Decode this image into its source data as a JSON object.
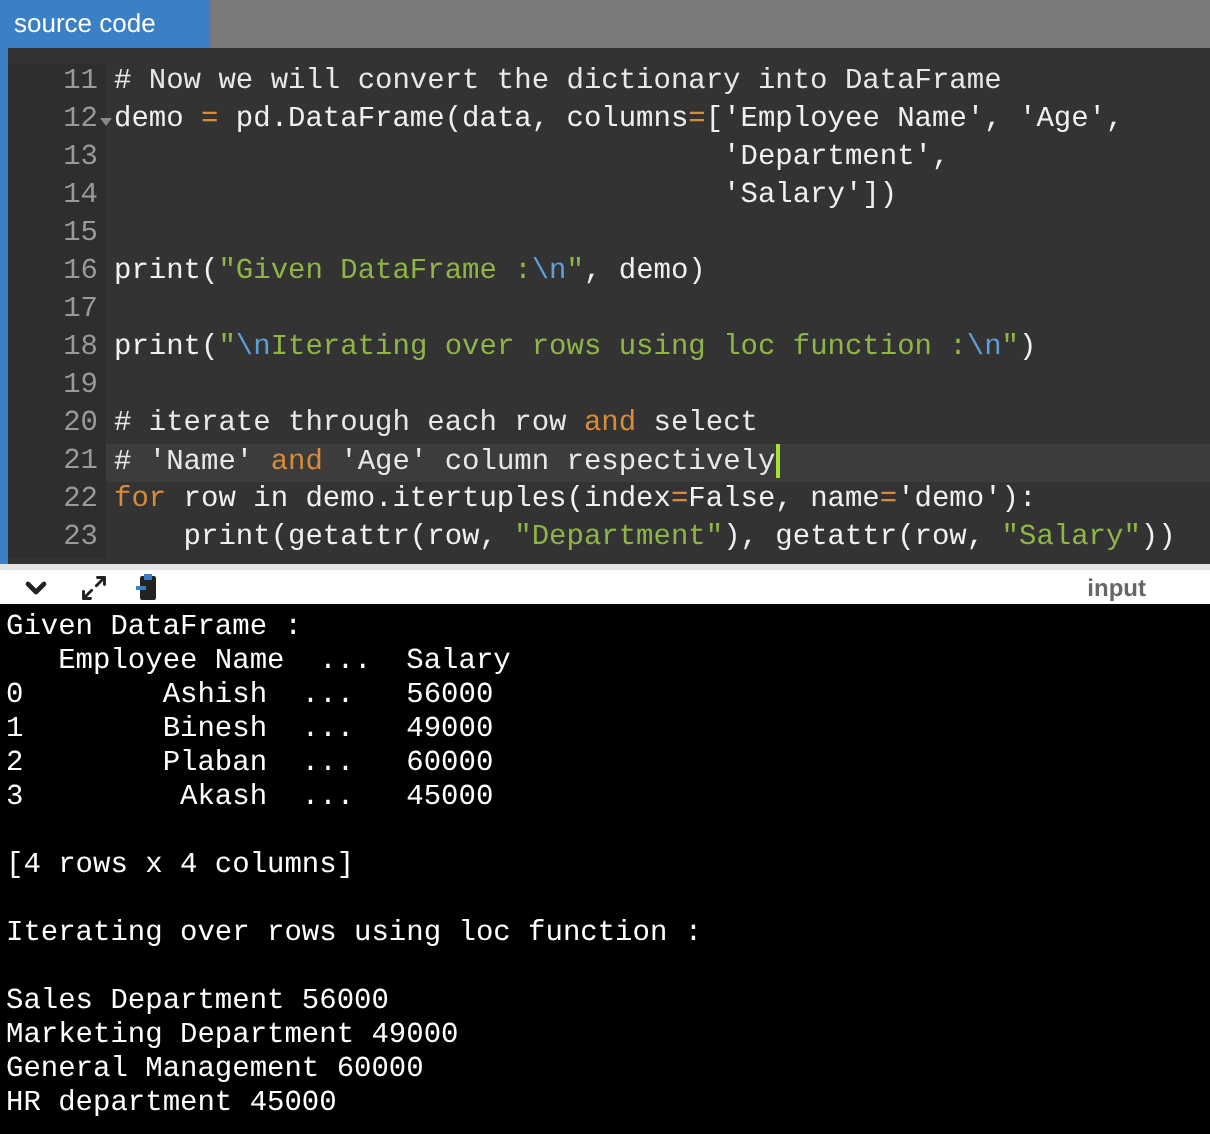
{
  "tab": {
    "label": "source code",
    "selected": true
  },
  "code_lines": [
    {
      "number": "11",
      "foldable": false,
      "active": false,
      "tokens": [
        {
          "kind": "comment",
          "text": "# Now we will convert the dictionary into DataFrame"
        }
      ]
    },
    {
      "number": "12",
      "foldable": true,
      "active": false,
      "tokens": [
        {
          "kind": "plain",
          "text": "demo "
        },
        {
          "kind": "op",
          "text": "="
        },
        {
          "kind": "plain",
          "text": " pd.DataFrame(data, columns"
        },
        {
          "kind": "op",
          "text": "="
        },
        {
          "kind": "plain",
          "text": "['Employee Name', 'Age',"
        }
      ]
    },
    {
      "number": "13",
      "foldable": false,
      "active": false,
      "tokens": [
        {
          "kind": "plain",
          "text": "                                   'Department',"
        }
      ]
    },
    {
      "number": "14",
      "foldable": false,
      "active": false,
      "tokens": [
        {
          "kind": "plain",
          "text": "                                   'Salary'])"
        }
      ]
    },
    {
      "number": "15",
      "foldable": false,
      "active": false
    },
    {
      "number": "16",
      "foldable": false,
      "active": false,
      "tokens": [
        {
          "kind": "plain",
          "text": "print("
        },
        {
          "kind": "str",
          "text": "\"Given DataFrame :"
        },
        {
          "kind": "esc",
          "text": "\\n"
        },
        {
          "kind": "str",
          "text": "\""
        },
        {
          "kind": "plain",
          "text": ", demo)"
        }
      ]
    },
    {
      "number": "17",
      "foldable": false,
      "active": false
    },
    {
      "number": "18",
      "foldable": false,
      "active": false,
      "tokens": [
        {
          "kind": "plain",
          "text": "print("
        },
        {
          "kind": "str",
          "text": "\""
        },
        {
          "kind": "esc",
          "text": "\\n"
        },
        {
          "kind": "str",
          "text": "Iterating over rows using loc function :"
        },
        {
          "kind": "esc",
          "text": "\\n"
        },
        {
          "kind": "str",
          "text": "\""
        },
        {
          "kind": "plain",
          "text": ")"
        }
      ]
    },
    {
      "number": "19",
      "foldable": false,
      "active": false
    },
    {
      "number": "20",
      "foldable": false,
      "active": false,
      "tokens": [
        {
          "kind": "comment",
          "text": "# iterate through each row "
        },
        {
          "kind": "kw",
          "text": "and"
        },
        {
          "kind": "comment",
          "text": " select"
        }
      ]
    },
    {
      "number": "21",
      "foldable": false,
      "active": true,
      "tokens": [
        {
          "kind": "comment",
          "text": "# 'Name' "
        },
        {
          "kind": "kw",
          "text": "and"
        },
        {
          "kind": "comment",
          "text": " 'Age' column respectively"
        }
      ]
    },
    {
      "number": "22",
      "foldable": false,
      "active": false,
      "tokens": [
        {
          "kind": "kw",
          "text": "for"
        },
        {
          "kind": "plain",
          "text": " row in demo.itertuples(index"
        },
        {
          "kind": "op",
          "text": "="
        },
        {
          "kind": "plain",
          "text": "False, name"
        },
        {
          "kind": "op",
          "text": "="
        },
        {
          "kind": "plain",
          "text": "'demo'):"
        }
      ]
    },
    {
      "number": "23",
      "foldable": false,
      "active": false,
      "tokens": [
        {
          "kind": "plain",
          "text": "    print(getattr(row, "
        },
        {
          "kind": "str",
          "text": "\"Department\""
        },
        {
          "kind": "plain",
          "text": "), getattr(row, "
        },
        {
          "kind": "str",
          "text": "\"Salary\""
        },
        {
          "kind": "plain",
          "text": "))"
        }
      ]
    }
  ],
  "output_toolbar": {
    "label": "input"
  },
  "output_blocks": [
    [
      "Given DataFrame :",
      "   Employee Name  ...  Salary",
      "0        Ashish  ...   56000",
      "1        Binesh  ...   49000",
      "2        Plaban  ...   60000",
      "3         Akash  ...   45000"
    ],
    [
      "[4 rows x 4 columns]"
    ],
    [
      "Iterating over rows using loc function :"
    ],
    [
      "Sales Department 56000",
      "Marketing Department 49000",
      "General Management 60000",
      "HR department 45000"
    ]
  ]
}
